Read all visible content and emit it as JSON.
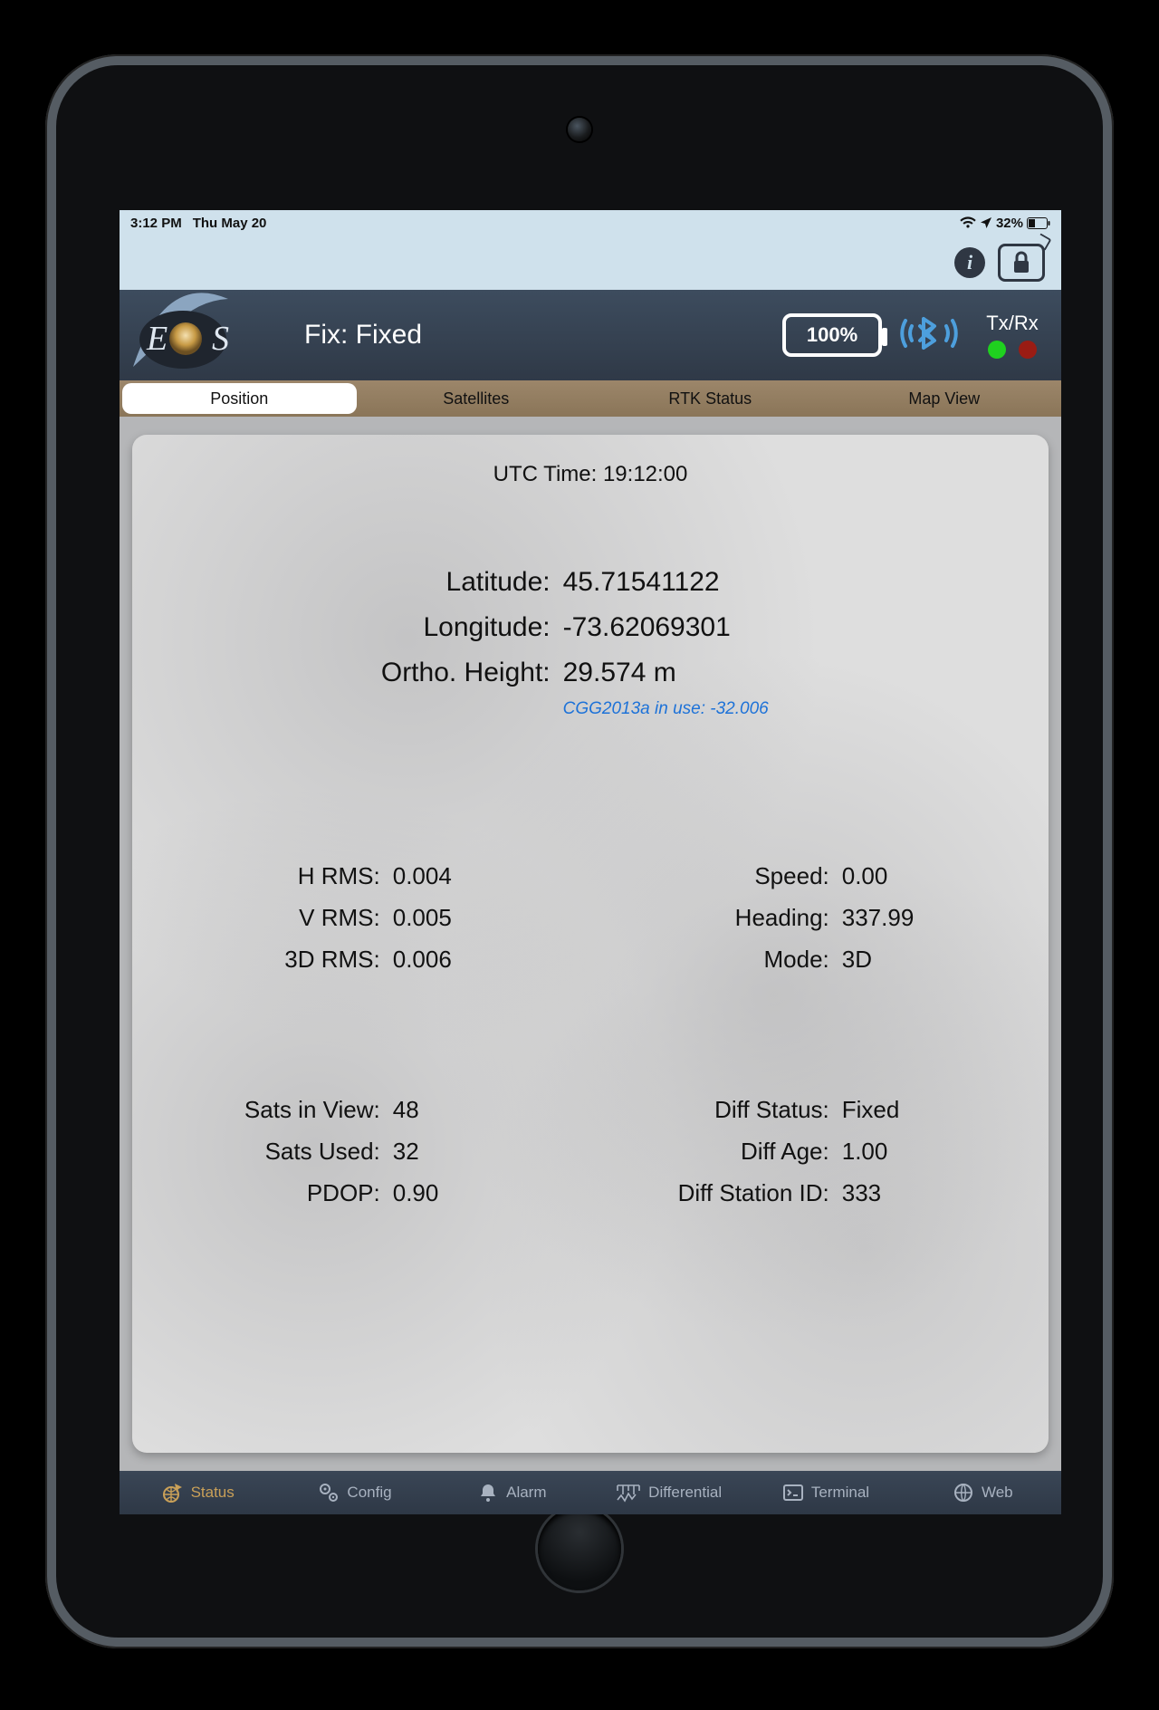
{
  "ios_status": {
    "time": "3:12 PM",
    "date": "Thu May 20",
    "battery_percent": "32%"
  },
  "header": {
    "logo_text": "EoS",
    "fix_label": "Fix: Fixed",
    "device_battery": "100%",
    "txrx_label": "Tx/Rx"
  },
  "tabs": [
    {
      "label": "Position",
      "active": true
    },
    {
      "label": "Satellites",
      "active": false
    },
    {
      "label": "RTK Status",
      "active": false
    },
    {
      "label": "Map View",
      "active": false
    }
  ],
  "position": {
    "utc_label": "UTC Time:",
    "utc_value": "19:12:00",
    "coords": {
      "lat_label": "Latitude:",
      "lat_value": "45.71541122",
      "lon_label": "Longitude:",
      "lon_value": "-73.62069301",
      "ortho_label": "Ortho. Height:",
      "ortho_value": "29.574 m",
      "geoid_note": "CGG2013a in use: -32.006"
    },
    "rms": {
      "h_label": "H RMS:",
      "h_value": "0.004",
      "v_label": "V RMS:",
      "v_value": "0.005",
      "d3_label": "3D RMS:",
      "d3_value": "0.006"
    },
    "motion": {
      "speed_label": "Speed:",
      "speed_value": "0.00",
      "heading_label": "Heading:",
      "heading_value": "337.99",
      "mode_label": "Mode:",
      "mode_value": "3D"
    },
    "sats": {
      "view_label": "Sats in View:",
      "view_value": "48",
      "used_label": "Sats Used:",
      "used_value": "32",
      "pdop_label": "PDOP:",
      "pdop_value": "0.90"
    },
    "diff": {
      "status_label": "Diff Status:",
      "status_value": "Fixed",
      "age_label": "Diff Age:",
      "age_value": "1.00",
      "station_label": "Diff Station ID:",
      "station_value": "333"
    }
  },
  "bottom_nav": [
    {
      "label": "Status"
    },
    {
      "label": "Config"
    },
    {
      "label": "Alarm"
    },
    {
      "label": "Differential"
    },
    {
      "label": "Terminal"
    },
    {
      "label": "Web"
    }
  ]
}
